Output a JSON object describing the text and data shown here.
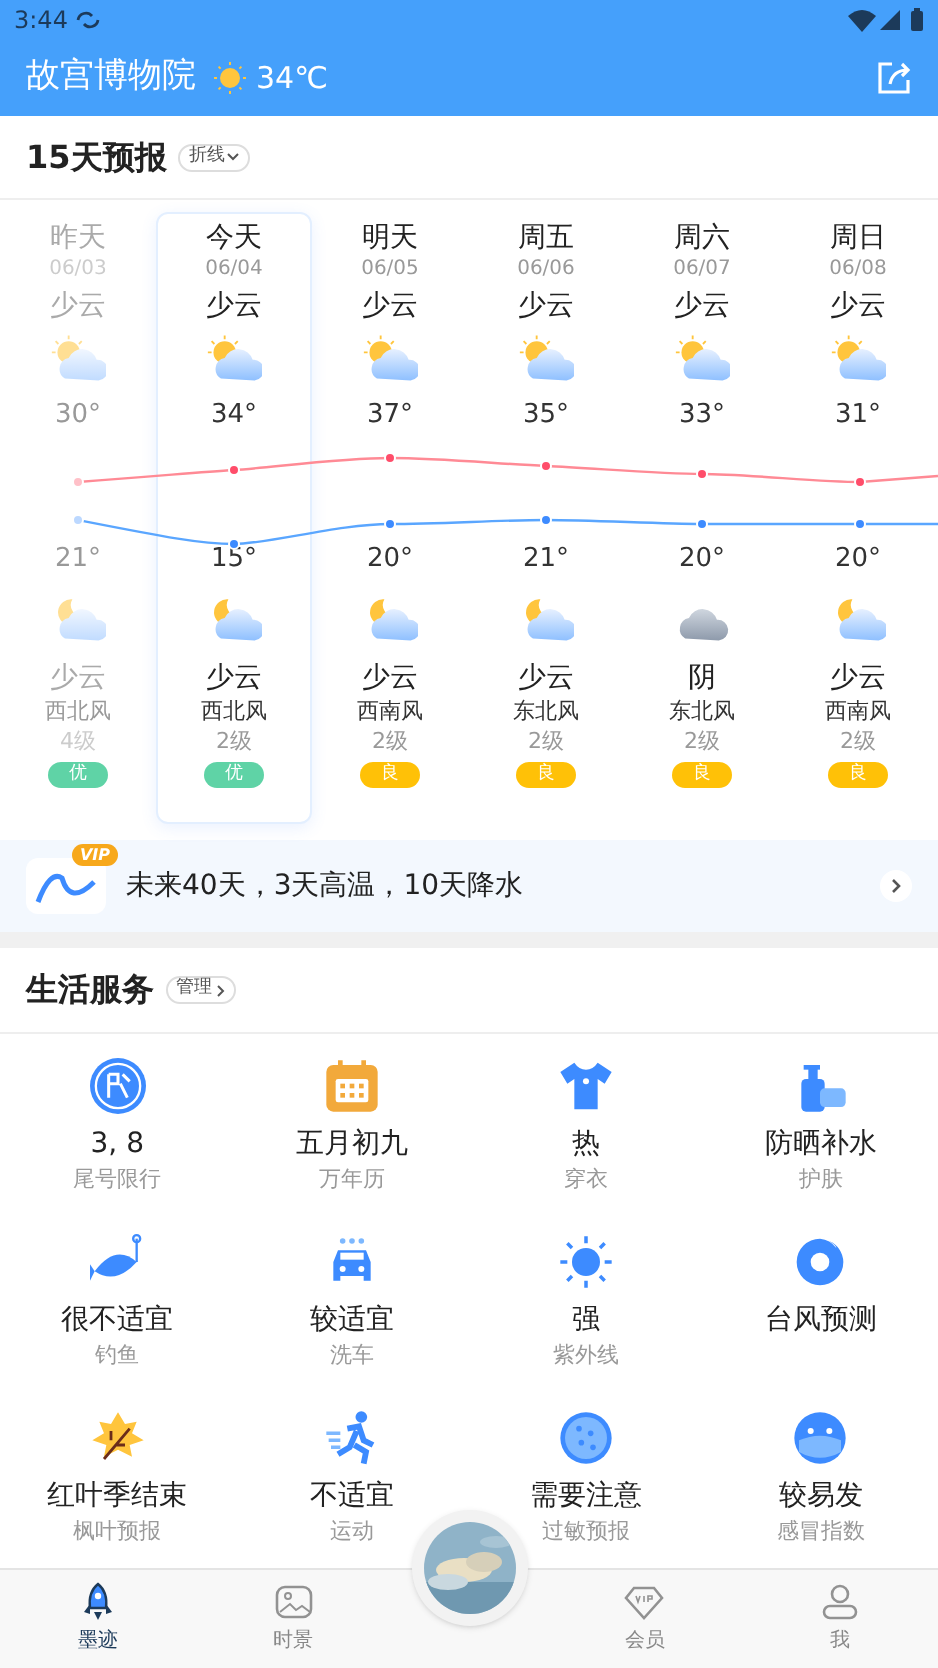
{
  "status_bar": {
    "time": "3:44"
  },
  "header": {
    "location": "故宫博物院",
    "temperature": "34℃"
  },
  "forecast": {
    "title": "15天预报",
    "mode": "折线",
    "days": [
      {
        "name": "昨天",
        "date": "06/03",
        "day": {
          "desc": "少云",
          "kind": "partly"
        },
        "high": "30°",
        "low": "21°",
        "night": {
          "desc": "少云",
          "kind": "partly_night"
        },
        "wind": "西北风",
        "wind_level": "4级",
        "aqi": {
          "text": "优",
          "color": "#5fd3a6"
        },
        "past": true,
        "selected": false
      },
      {
        "name": "今天",
        "date": "06/04",
        "day": {
          "desc": "少云",
          "kind": "partly"
        },
        "high": "34°",
        "low": "15°",
        "night": {
          "desc": "少云",
          "kind": "partly_night"
        },
        "wind": "西北风",
        "wind_level": "2级",
        "aqi": {
          "text": "优",
          "color": "#5fd3a6"
        },
        "past": false,
        "selected": true
      },
      {
        "name": "明天",
        "date": "06/05",
        "day": {
          "desc": "少云",
          "kind": "partly"
        },
        "high": "37°",
        "low": "20°",
        "night": {
          "desc": "少云",
          "kind": "partly_night"
        },
        "wind": "西南风",
        "wind_level": "2级",
        "aqi": {
          "text": "良",
          "color": "#ffc107"
        },
        "past": false,
        "selected": false
      },
      {
        "name": "周五",
        "date": "06/06",
        "day": {
          "desc": "少云",
          "kind": "partly"
        },
        "high": "35°",
        "low": "21°",
        "night": {
          "desc": "少云",
          "kind": "partly_night"
        },
        "wind": "东北风",
        "wind_level": "2级",
        "aqi": {
          "text": "良",
          "color": "#ffc107"
        },
        "past": false,
        "selected": false
      },
      {
        "name": "周六",
        "date": "06/07",
        "day": {
          "desc": "少云",
          "kind": "partly"
        },
        "high": "33°",
        "low": "20°",
        "night": {
          "desc": "阴",
          "kind": "overcast"
        },
        "wind": "东北风",
        "wind_level": "2级",
        "aqi": {
          "text": "良",
          "color": "#ffc107"
        },
        "past": false,
        "selected": false
      },
      {
        "name": "周日",
        "date": "06/08",
        "day": {
          "desc": "少云",
          "kind": "partly"
        },
        "high": "31°",
        "low": "20°",
        "night": {
          "desc": "少云",
          "kind": "partly_night"
        },
        "wind": "西南风",
        "wind_level": "2级",
        "aqi": {
          "text": "良",
          "color": "#ffc107"
        },
        "past": false,
        "selected": false
      }
    ]
  },
  "vip_banner": {
    "badge": "VIP",
    "text": "未来40天，3天高温，10天降水"
  },
  "life_services": {
    "title": "生活服务",
    "manage": "管理",
    "items": [
      {
        "value": "3, 8",
        "label": "尾号限行"
      },
      {
        "value": "五月初九",
        "label": "万年历"
      },
      {
        "value": "热",
        "label": "穿衣"
      },
      {
        "value": "防晒补水",
        "label": "护肤"
      },
      {
        "value": "很不适宜",
        "label": "钓鱼"
      },
      {
        "value": "较适宜",
        "label": "洗车"
      },
      {
        "value": "强",
        "label": "紫外线"
      },
      {
        "value": "台风预测"
      },
      {
        "value": "红叶季结束",
        "label": "枫叶预报"
      },
      {
        "value": "不适宜",
        "label": "运动"
      },
      {
        "value": "需要注意",
        "label": "过敏预报"
      },
      {
        "value": "较易发",
        "label": "感冒指数"
      }
    ]
  },
  "bottom_nav": [
    {
      "kind": "tab",
      "label": "墨迹",
      "selected": true
    },
    {
      "kind": "tab",
      "label": "时景",
      "selected": false
    },
    {
      "kind": "picture"
    },
    {
      "kind": "tab",
      "label": "会员",
      "selected": false
    },
    {
      "kind": "tab",
      "label": "我",
      "selected": false
    }
  ]
}
